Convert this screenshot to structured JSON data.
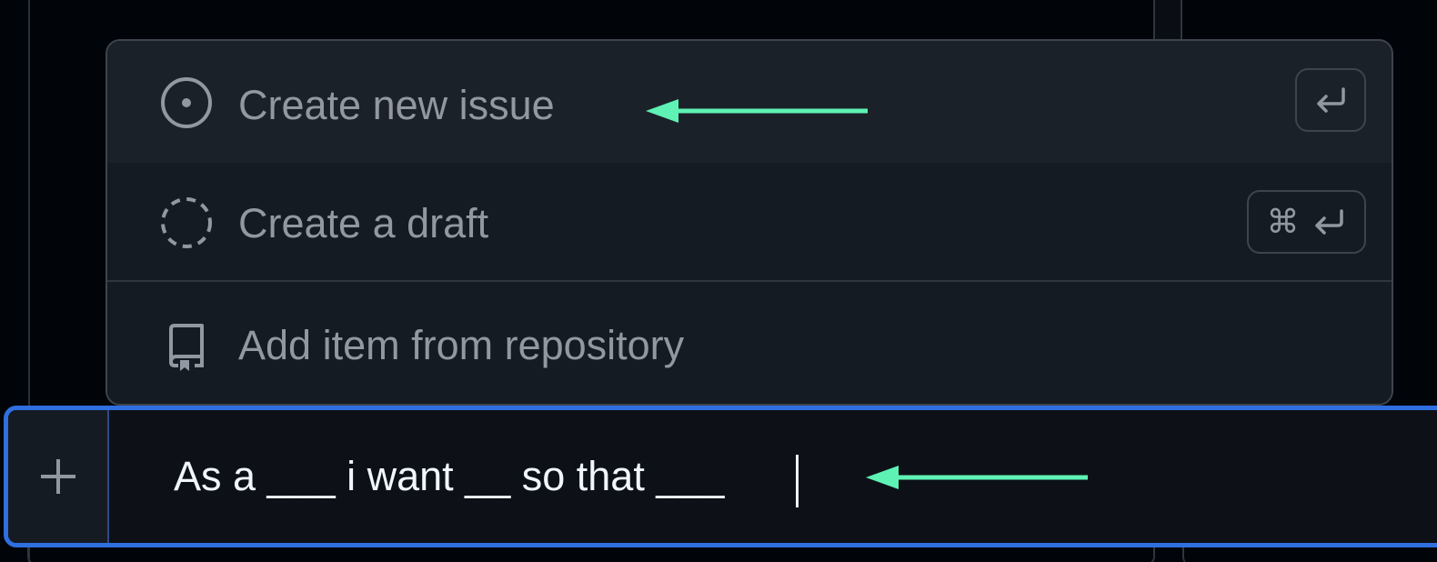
{
  "menu": {
    "items": [
      {
        "label": "Create new issue",
        "icon": "issue-opened-icon",
        "shortcut": "return-icon"
      },
      {
        "label": "Create a draft",
        "icon": "issue-draft-icon",
        "shortcut_prefix": "⌘",
        "shortcut": "return-icon"
      },
      {
        "label": "Add item from repository",
        "icon": "repo-icon"
      }
    ]
  },
  "input": {
    "value": "As a ___ i want __ so that ___",
    "add_icon": "plus-icon"
  },
  "annotations": {
    "arrow_color": "#5ef2b4"
  },
  "colors": {
    "focus_border": "#2f6fe0",
    "menu_bg": "#151b23",
    "highlight_bg": "#1b2129",
    "muted_text": "#9198a1"
  }
}
